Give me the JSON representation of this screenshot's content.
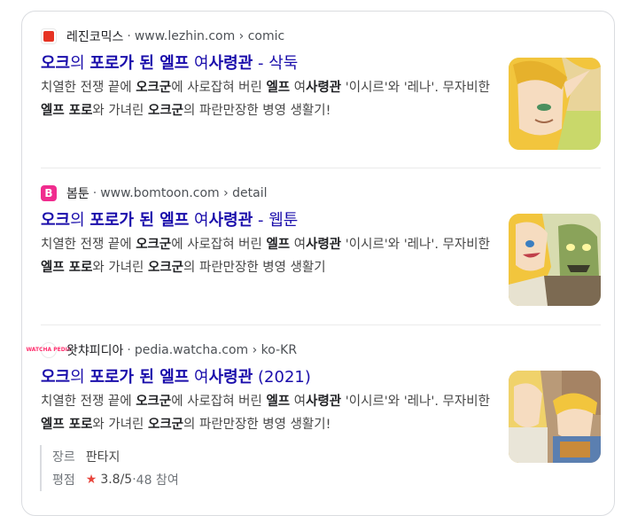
{
  "results": [
    {
      "site_name": "레진코믹스",
      "url": "www.lezhin.com › comic",
      "title_bold1": "오크",
      "title_mid1": "의 ",
      "title_bold2": "포로가 된 엘프",
      "title_mid2": " 여",
      "title_bold3": "사령관",
      "title_suffix": " - 삭둑",
      "snippet": [
        {
          "t": "치열한 전쟁 끝에 ",
          "b": false
        },
        {
          "t": "오크군",
          "b": true
        },
        {
          "t": "에 사로잡혀 버린 ",
          "b": false
        },
        {
          "t": "엘프",
          "b": true
        },
        {
          "t": " 여",
          "b": false
        },
        {
          "t": "사령관",
          "b": true
        },
        {
          "t": " '이시르'와 '레나'. 무자비한 ",
          "b": false
        },
        {
          "t": "엘프 포로",
          "b": true
        },
        {
          "t": "와 가녀린 ",
          "b": false
        },
        {
          "t": "오크군",
          "b": true
        },
        {
          "t": "의 파란만장한 병영 생활기!",
          "b": false
        }
      ],
      "thumb_icon": "elf-comic-thumbnail",
      "favicon_icon": "lezhin-favicon"
    },
    {
      "site_name": "봄툰",
      "url": "www.bomtoon.com › detail",
      "title_bold1": "오크",
      "title_mid1": "의 ",
      "title_bold2": "포로가 된 엘프",
      "title_mid2": " 여",
      "title_bold3": "사령관",
      "title_suffix": " - 웹툰",
      "snippet": [
        {
          "t": "치열한 전쟁 끝에 ",
          "b": false
        },
        {
          "t": "오크군",
          "b": true
        },
        {
          "t": "에 사로잡혀 버린 ",
          "b": false
        },
        {
          "t": "엘프",
          "b": true
        },
        {
          "t": " 여",
          "b": false
        },
        {
          "t": "사령관",
          "b": true
        },
        {
          "t": " '이시르'와 '레나'. 무자비한 ",
          "b": false
        },
        {
          "t": "엘프 포로",
          "b": true
        },
        {
          "t": "와 가녀린 ",
          "b": false
        },
        {
          "t": "오크군",
          "b": true
        },
        {
          "t": "의 파란만장한 병영 생활기",
          "b": false
        }
      ],
      "thumb_icon": "elf-orc-comic-thumbnail",
      "favicon_label": "B",
      "favicon_icon": "bomtoon-favicon"
    },
    {
      "site_name": "왓챠피디아",
      "url": "pedia.watcha.com › ko-KR",
      "title_bold1": "오크",
      "title_mid1": "의 ",
      "title_bold2": "포로가 된 엘프",
      "title_mid2": " 여",
      "title_bold3": "사령관",
      "title_suffix": " (2021)",
      "snippet": [
        {
          "t": "치열한 전쟁 끝에 ",
          "b": false
        },
        {
          "t": "오크군",
          "b": true
        },
        {
          "t": "에 사로잡혀 버린 ",
          "b": false
        },
        {
          "t": "엘프",
          "b": true
        },
        {
          "t": " 여",
          "b": false
        },
        {
          "t": "사령관",
          "b": true
        },
        {
          "t": " '이시르'와 '레나'. 무자비한 ",
          "b": false
        },
        {
          "t": "엘프 포로",
          "b": true
        },
        {
          "t": "와 가녀린 ",
          "b": false
        },
        {
          "t": "오크군",
          "b": true
        },
        {
          "t": "의 파란만장한 병영 생활기!",
          "b": false
        }
      ],
      "thumb_icon": "elf-library-comic-thumbnail",
      "favicon_label": "WATCHA PEDIA",
      "favicon_icon": "watcha-favicon",
      "genre_label": "장르",
      "genre_value": "판타지",
      "rating_label": "평점",
      "rating_value": "3.8/5",
      "rating_sep": " · ",
      "rating_count": "48 참여",
      "star_icon": "star-icon"
    }
  ],
  "colors": {
    "title_link": "#1a0dab",
    "rating_star": "#e8453c",
    "lezhin_brand": "#e63323",
    "bomtoon_brand": "#f02c8e"
  }
}
